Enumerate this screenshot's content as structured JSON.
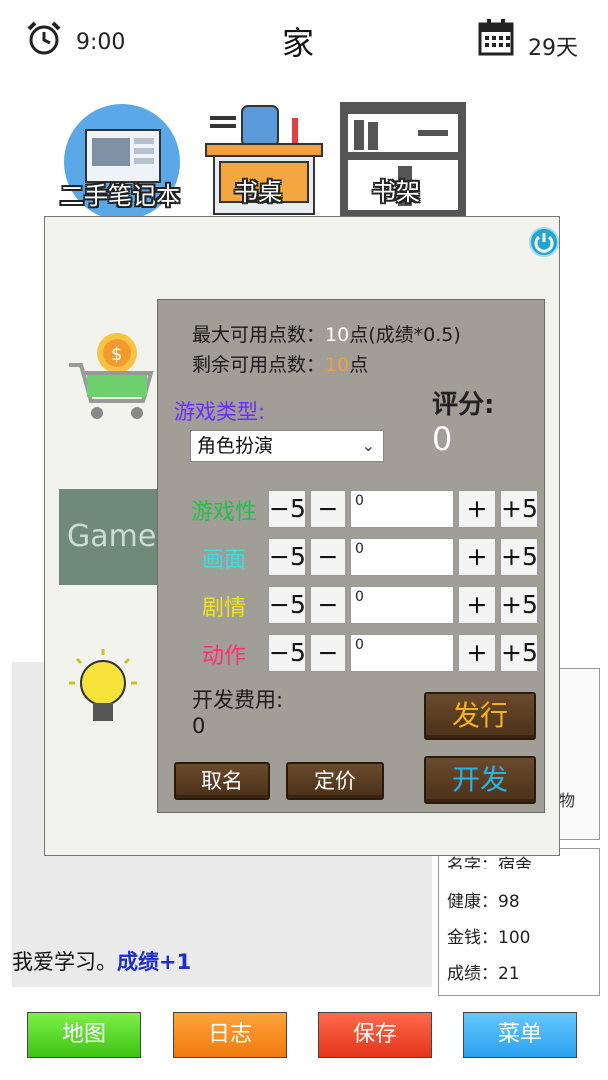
{
  "status_bar": {
    "time": "9:00",
    "location": "家",
    "day": "29天"
  },
  "furniture": [
    {
      "label": "二手笔记本"
    },
    {
      "label": "书桌"
    },
    {
      "label": "书架"
    }
  ],
  "dialog": {
    "left_tile": "Game",
    "max_points_label": "最大可用点数：",
    "max_points_value": "10",
    "max_points_suffix": "点(成绩*0.5)",
    "remaining_points_label": "剩余可用点数：",
    "remaining_points_value": "10",
    "remaining_points_suffix": "点",
    "game_type_label": "游戏类型:",
    "game_type_selected": "角色扮演",
    "score_label": "评分:",
    "score_value": "0",
    "attributes": [
      {
        "name": "游戏性",
        "color": "#22c04a",
        "value": "0"
      },
      {
        "name": "画面",
        "color": "#2fe4e4",
        "value": "0"
      },
      {
        "name": "剧情",
        "color": "#f2e21a",
        "value": "0"
      },
      {
        "name": "动作",
        "color": "#ff2d7a",
        "value": "0"
      }
    ],
    "step_buttons": {
      "minus5": "−5",
      "minus1": "−",
      "plus1": "+",
      "plus5": "+5"
    },
    "dev_cost_label": "开发费用:",
    "dev_cost_value": "0",
    "name_button": "取名",
    "price_button": "定价",
    "publish_button": "发行",
    "develop_button": "开发",
    "publish_color": "#f5b21c",
    "develop_color": "#26b4e8"
  },
  "background": {
    "log_text": "我爱学习。",
    "log_highlight": "成绩+1",
    "stats": {
      "name_line": "名字：宿舍",
      "health_line": "健康：98",
      "money_line": "金钱：100",
      "grade_line": "成绩：21"
    },
    "side_panel_text": "物"
  },
  "nav": {
    "map": "地图",
    "log": "日志",
    "save": "保存",
    "menu": "菜单"
  }
}
